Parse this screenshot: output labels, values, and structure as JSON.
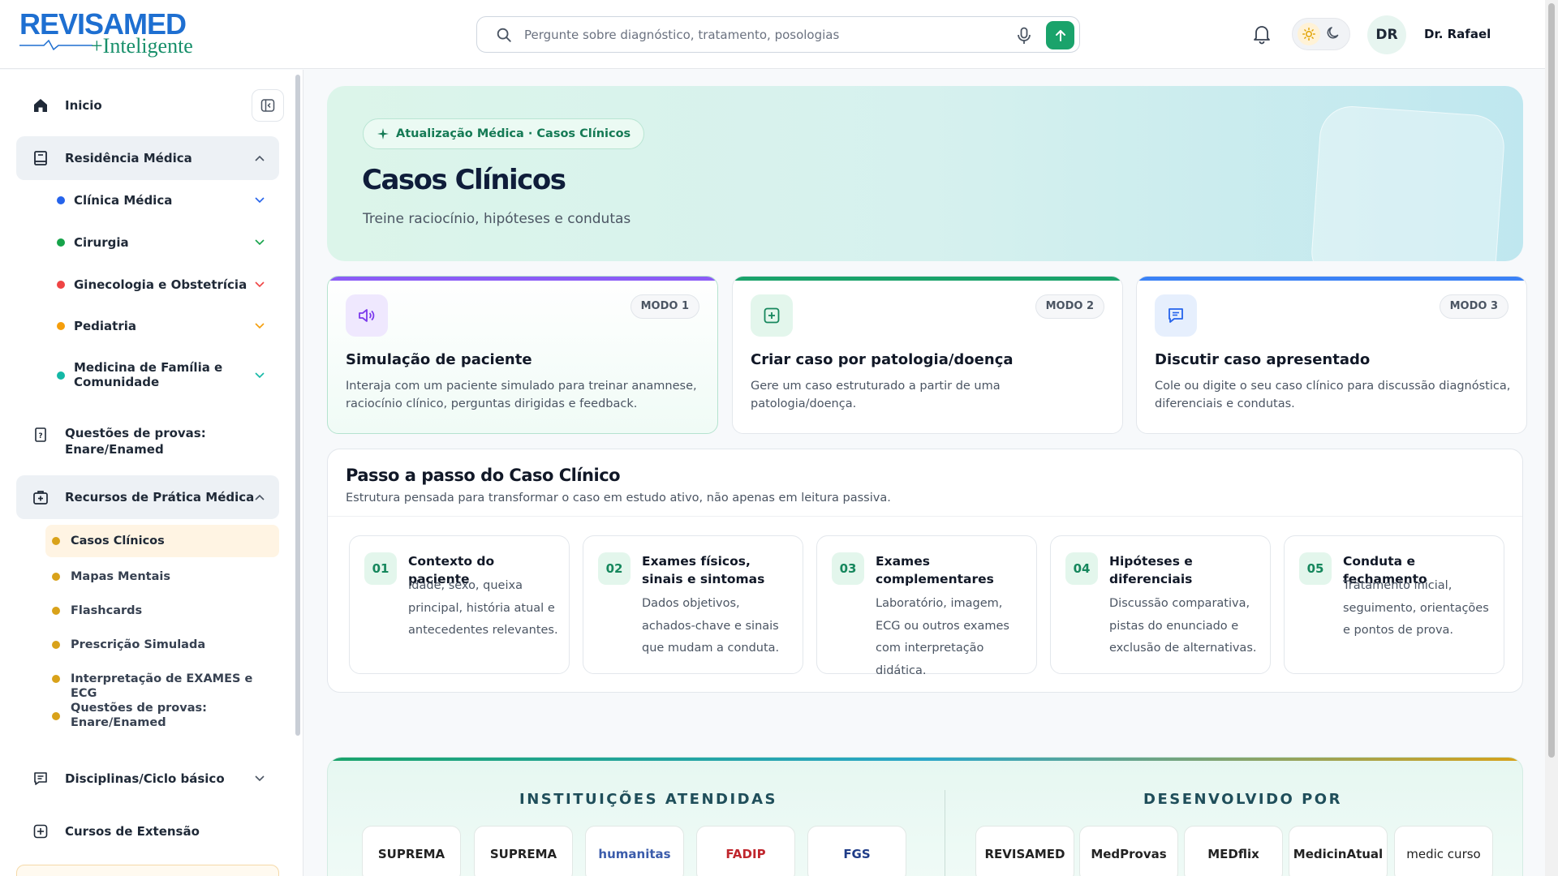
{
  "header": {
    "logo_top": "REVISAMED",
    "logo_bottom": "+Inteligente",
    "search_placeholder": "Pergunte sobre diagnóstico, tratamento, posologias",
    "avatar_initials": "DR",
    "username": "Dr. Rafael"
  },
  "sidebar": {
    "home": "Inicio",
    "residencia": "Residência Médica",
    "specialties": [
      {
        "label": "Clínica Médica",
        "color": "#2563eb"
      },
      {
        "label": "Cirurgia",
        "color": "#16a34a"
      },
      {
        "label": "Ginecologia e Obstetrícia",
        "color": "#ef4444"
      },
      {
        "label": "Pediatria",
        "color": "#f59e0b"
      },
      {
        "label": "Medicina de Família e Comunidade",
        "color": "#14b8a6"
      }
    ],
    "questoes": "Questões de provas: Enare/Enamed",
    "recursos": "Recursos de Prática Médica",
    "resources": [
      "Casos Clínicos",
      "Mapas Mentais",
      "Flashcards",
      "Prescrição Simulada",
      "Interpretação de EXAMES e ECG",
      "Questões de provas: Enare/Enamed"
    ],
    "disciplinas": "Disciplinas/Ciclo básico",
    "cursos": "Cursos de Extensão"
  },
  "hero": {
    "pill": "Atualização Médica · Casos Clínicos",
    "title": "Casos Clínicos",
    "subtitle": "Treine raciocínio, hipóteses e condutas"
  },
  "modes": [
    {
      "badge": "MODO 1",
      "title": "Simulação de paciente",
      "desc": "Interaja com um paciente simulado para treinar anamnese, raciocínio clínico, perguntas dirigidas e feedback.",
      "accent": "#8b5cf6"
    },
    {
      "badge": "MODO 2",
      "title": "Criar caso por patologia/doença",
      "desc": "Gere um caso estruturado a partir de uma patologia/doença.",
      "accent": "#1aa36b"
    },
    {
      "badge": "MODO 3",
      "title": "Discutir caso apresentado",
      "desc": "Cole ou digite o seu caso clínico para discussão diagnóstica, diferenciais e condutas.",
      "accent": "#3b82f6"
    }
  ],
  "steps": {
    "title": "Passo a passo do Caso Clínico",
    "subtitle": "Estrutura pensada para transformar o caso em estudo ativo, não apenas em leitura passiva.",
    "items": [
      {
        "num": "01",
        "title": "Contexto do paciente",
        "desc": "Idade, sexo, queixa principal, história atual e antecedentes relevantes."
      },
      {
        "num": "02",
        "title": "Exames físicos, sinais e sintomas",
        "desc": "Dados objetivos, achados-chave e sinais que mudam a conduta."
      },
      {
        "num": "03",
        "title": "Exames complementares",
        "desc": "Laboratório, imagem, ECG ou outros exames com interpretação didática."
      },
      {
        "num": "04",
        "title": "Hipóteses e diferenciais",
        "desc": "Discussão comparativa, pistas do enunciado e exclusão de alternativas."
      },
      {
        "num": "05",
        "title": "Conduta e fechamento",
        "desc": "Tratamento inicial, seguimento, orientações e pontos de prova."
      }
    ]
  },
  "footer": {
    "institutions_title": "INSTITUIÇÕES ATENDIDAS",
    "developed_title": "DESENVOLVIDO POR",
    "institutions": [
      "SUPREMA",
      "SUPREMA",
      "humanitas",
      "FADIP",
      "FGS"
    ],
    "developers": [
      "REVISAMED",
      "MedProvas",
      "MEDflix",
      "MedicinAtual",
      "medic curso"
    ]
  }
}
